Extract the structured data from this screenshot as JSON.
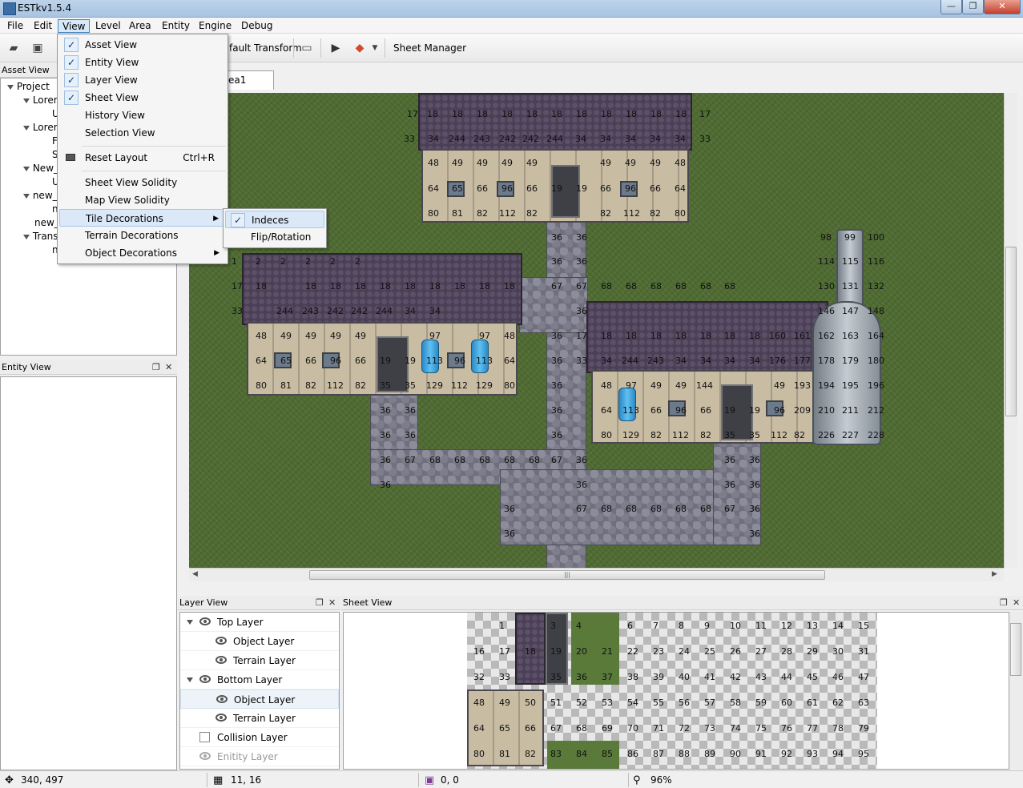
{
  "app": {
    "title": "ESTkv1.5.4"
  },
  "menu": [
    "File",
    "Edit",
    "View",
    "Level",
    "Area",
    "Entity",
    "Engine",
    "Debug"
  ],
  "toolbar": {
    "transform_label": "fault Transform",
    "sheet_manager": "Sheet Manager"
  },
  "asset_view": {
    "title": "Asset View",
    "items": [
      "Project",
      "Lorer",
      "U",
      "Lorer",
      "F",
      "S",
      "New_",
      "U",
      "new_",
      "n",
      "new_",
      "Trans",
      "n"
    ]
  },
  "entity_view": {
    "title": "Entity View"
  },
  "view_menu": {
    "items": [
      {
        "label": "Asset View",
        "checked": true
      },
      {
        "label": "Entity View",
        "checked": true
      },
      {
        "label": "Layer View",
        "checked": true
      },
      {
        "label": "Sheet View",
        "checked": true
      },
      {
        "label": "History View",
        "checked": false
      },
      {
        "label": "Selection View",
        "checked": false
      },
      {
        "label": "Reset Layout",
        "shortcut": "Ctrl+R"
      },
      {
        "label": "Sheet View Solidity"
      },
      {
        "label": "Map View Solidity"
      },
      {
        "label": "Tile Decorations",
        "submenu": true
      },
      {
        "label": "Terrain Decorations"
      },
      {
        "label": "Object Decorations",
        "submenu": true
      }
    ]
  },
  "tile_submenu": {
    "items": [
      {
        "label": "Indeces",
        "checked": true
      },
      {
        "label": "Flip/Rotation",
        "checked": false
      }
    ]
  },
  "map": {
    "tab": "ea1",
    "hscroll_grip": "|||"
  },
  "map_numbers": [
    [
      "17",
      508,
      143
    ],
    [
      "18",
      533,
      143
    ],
    [
      "18",
      564,
      143
    ],
    [
      "18",
      595,
      143
    ],
    [
      "18",
      626,
      143
    ],
    [
      "18",
      657,
      143
    ],
    [
      "18",
      688,
      143
    ],
    [
      "18",
      719,
      143
    ],
    [
      "18",
      750,
      143
    ],
    [
      "18",
      781,
      143
    ],
    [
      "18",
      812,
      143
    ],
    [
      "18",
      843,
      143
    ],
    [
      "17",
      873,
      143
    ],
    [
      "33",
      504,
      174
    ],
    [
      "34",
      534,
      174
    ],
    [
      "244",
      560,
      174
    ],
    [
      "243",
      591,
      174
    ],
    [
      "242",
      623,
      174
    ],
    [
      "242",
      652,
      174
    ],
    [
      "244",
      682,
      174
    ],
    [
      "34",
      718,
      174
    ],
    [
      "34",
      749,
      174
    ],
    [
      "34",
      780,
      174
    ],
    [
      "34",
      811,
      174
    ],
    [
      "34",
      842,
      174
    ],
    [
      "33",
      873,
      174
    ],
    [
      "48",
      534,
      204
    ],
    [
      "49",
      564,
      204
    ],
    [
      "49",
      595,
      204
    ],
    [
      "49",
      626,
      204
    ],
    [
      "49",
      657,
      204
    ],
    [
      "49",
      749,
      204
    ],
    [
      "49",
      780,
      204
    ],
    [
      "49",
      811,
      204
    ],
    [
      "48",
      842,
      204
    ],
    [
      "64",
      534,
      236
    ],
    [
      "65",
      564,
      236
    ],
    [
      "66",
      595,
      236
    ],
    [
      "96",
      626,
      236
    ],
    [
      "66",
      657,
      236
    ],
    [
      "19",
      688,
      236
    ],
    [
      "19",
      719,
      236
    ],
    [
      "66",
      749,
      236
    ],
    [
      "96",
      780,
      236
    ],
    [
      "66",
      811,
      236
    ],
    [
      "64",
      842,
      236
    ],
    [
      "80",
      534,
      267
    ],
    [
      "81",
      564,
      267
    ],
    [
      "82",
      595,
      267
    ],
    [
      "112",
      623,
      267
    ],
    [
      "82",
      657,
      267
    ],
    [
      "82",
      749,
      267
    ],
    [
      "112",
      778,
      267
    ],
    [
      "82",
      811,
      267
    ],
    [
      "80",
      842,
      267
    ],
    [
      "36",
      688,
      297
    ],
    [
      "36",
      719,
      297
    ],
    [
      "98",
      1024,
      297
    ],
    [
      "99",
      1054,
      297
    ],
    [
      "100",
      1083,
      297
    ],
    [
      "1",
      289,
      327
    ],
    [
      "2",
      319,
      327
    ],
    [
      "2",
      350,
      327
    ],
    [
      "2",
      381,
      327
    ],
    [
      "2",
      412,
      327
    ],
    [
      "2",
      443,
      327
    ],
    [
      "36",
      688,
      327
    ],
    [
      "36",
      719,
      327
    ],
    [
      "114",
      1021,
      327
    ],
    [
      "115",
      1051,
      327
    ],
    [
      "116",
      1083,
      327
    ],
    [
      "17",
      289,
      358
    ],
    [
      "18",
      319,
      358
    ],
    [
      "18",
      381,
      358
    ],
    [
      "18",
      412,
      358
    ],
    [
      "18",
      443,
      358
    ],
    [
      "18",
      474,
      358
    ],
    [
      "18",
      505,
      358
    ],
    [
      "18",
      536,
      358
    ],
    [
      "18",
      567,
      358
    ],
    [
      "18",
      598,
      358
    ],
    [
      "18",
      629,
      358
    ],
    [
      "67",
      688,
      358
    ],
    [
      "67",
      719,
      358
    ],
    [
      "68",
      750,
      358
    ],
    [
      "68",
      781,
      358
    ],
    [
      "68",
      812,
      358
    ],
    [
      "68",
      843,
      358
    ],
    [
      "68",
      874,
      358
    ],
    [
      "68",
      904,
      358
    ],
    [
      "130",
      1021,
      358
    ],
    [
      "131",
      1051,
      358
    ],
    [
      "132",
      1083,
      358
    ],
    [
      "33",
      289,
      389
    ],
    [
      "244",
      345,
      389
    ],
    [
      "243",
      377,
      389
    ],
    [
      "242",
      408,
      389
    ],
    [
      "242",
      438,
      389
    ],
    [
      "244",
      469,
      389
    ],
    [
      "34",
      505,
      389
    ],
    [
      "34",
      536,
      389
    ],
    [
      "36",
      719,
      389
    ],
    [
      "146",
      1021,
      389
    ],
    [
      "147",
      1051,
      389
    ],
    [
      "148",
      1083,
      389
    ],
    [
      "48",
      319,
      420
    ],
    [
      "49",
      350,
      420
    ],
    [
      "49",
      381,
      420
    ],
    [
      "49",
      412,
      420
    ],
    [
      "49",
      443,
      420
    ],
    [
      "97",
      536,
      420
    ],
    [
      "97",
      598,
      420
    ],
    [
      "48",
      629,
      420
    ],
    [
      "36",
      688,
      420
    ],
    [
      "17",
      719,
      420
    ],
    [
      "18",
      750,
      420
    ],
    [
      "18",
      781,
      420
    ],
    [
      "18",
      812,
      420
    ],
    [
      "18",
      843,
      420
    ],
    [
      "18",
      874,
      420
    ],
    [
      "18",
      904,
      420
    ],
    [
      "18",
      935,
      420
    ],
    [
      "160",
      960,
      420
    ],
    [
      "161",
      991,
      420
    ],
    [
      "162",
      1021,
      420
    ],
    [
      "163",
      1051,
      420
    ],
    [
      "164",
      1083,
      420
    ],
    [
      "64",
      319,
      451
    ],
    [
      "65",
      350,
      451
    ],
    [
      "66",
      381,
      451
    ],
    [
      "96",
      412,
      451
    ],
    [
      "66",
      443,
      451
    ],
    [
      "19",
      474,
      451
    ],
    [
      "19",
      505,
      451
    ],
    [
      "113",
      532,
      451
    ],
    [
      "96",
      567,
      451
    ],
    [
      "113",
      594,
      451
    ],
    [
      "64",
      629,
      451
    ],
    [
      "36",
      688,
      451
    ],
    [
      "33",
      719,
      451
    ],
    [
      "34",
      750,
      451
    ],
    [
      "244",
      776,
      451
    ],
    [
      "243",
      808,
      451
    ],
    [
      "34",
      843,
      451
    ],
    [
      "34",
      874,
      451
    ],
    [
      "34",
      904,
      451
    ],
    [
      "34",
      935,
      451
    ],
    [
      "176",
      960,
      451
    ],
    [
      "177",
      991,
      451
    ],
    [
      "178",
      1021,
      451
    ],
    [
      "179",
      1051,
      451
    ],
    [
      "180",
      1083,
      451
    ],
    [
      "80",
      319,
      482
    ],
    [
      "81",
      350,
      482
    ],
    [
      "82",
      381,
      482
    ],
    [
      "112",
      408,
      482
    ],
    [
      "82",
      443,
      482
    ],
    [
      "35",
      474,
      482
    ],
    [
      "35",
      505,
      482
    ],
    [
      "129",
      532,
      482
    ],
    [
      "112",
      563,
      482
    ],
    [
      "129",
      594,
      482
    ],
    [
      "80",
      629,
      482
    ],
    [
      "36",
      688,
      482
    ],
    [
      "48",
      750,
      482
    ],
    [
      "97",
      781,
      482
    ],
    [
      "49",
      812,
      482
    ],
    [
      "49",
      843,
      482
    ],
    [
      "144",
      869,
      482
    ],
    [
      "49",
      966,
      482
    ],
    [
      "193",
      991,
      482
    ],
    [
      "194",
      1021,
      482
    ],
    [
      "195",
      1051,
      482
    ],
    [
      "196",
      1083,
      482
    ],
    [
      "36",
      474,
      513
    ],
    [
      "36",
      505,
      513
    ],
    [
      "36",
      688,
      513
    ],
    [
      "64",
      750,
      513
    ],
    [
      "113",
      777,
      513
    ],
    [
      "66",
      812,
      513
    ],
    [
      "96",
      843,
      513
    ],
    [
      "66",
      874,
      513
    ],
    [
      "19",
      904,
      513
    ],
    [
      "19",
      935,
      513
    ],
    [
      "96",
      966,
      513
    ],
    [
      "209",
      991,
      513
    ],
    [
      "210",
      1021,
      513
    ],
    [
      "211",
      1051,
      513
    ],
    [
      "212",
      1083,
      513
    ],
    [
      "36",
      474,
      544
    ],
    [
      "36",
      505,
      544
    ],
    [
      "36",
      688,
      544
    ],
    [
      "80",
      750,
      544
    ],
    [
      "129",
      777,
      544
    ],
    [
      "82",
      812,
      544
    ],
    [
      "112",
      839,
      544
    ],
    [
      "82",
      874,
      544
    ],
    [
      "35",
      904,
      544
    ],
    [
      "35",
      935,
      544
    ],
    [
      "112",
      962,
      544
    ],
    [
      "82",
      991,
      544
    ],
    [
      "226",
      1021,
      544
    ],
    [
      "227",
      1051,
      544
    ],
    [
      "228",
      1083,
      544
    ],
    [
      "36",
      474,
      575
    ],
    [
      "67",
      505,
      575
    ],
    [
      "68",
      536,
      575
    ],
    [
      "68",
      567,
      575
    ],
    [
      "68",
      598,
      575
    ],
    [
      "68",
      629,
      575
    ],
    [
      "68",
      660,
      575
    ],
    [
      "67",
      688,
      575
    ],
    [
      "36",
      719,
      575
    ],
    [
      "36",
      904,
      575
    ],
    [
      "36",
      935,
      575
    ],
    [
      "36",
      474,
      606
    ],
    [
      "36",
      719,
      606
    ],
    [
      "36",
      904,
      606
    ],
    [
      "36",
      935,
      606
    ],
    [
      "36",
      629,
      636
    ],
    [
      "67",
      719,
      636
    ],
    [
      "68",
      750,
      636
    ],
    [
      "68",
      781,
      636
    ],
    [
      "68",
      812,
      636
    ],
    [
      "68",
      843,
      636
    ],
    [
      "68",
      874,
      636
    ],
    [
      "67",
      904,
      636
    ],
    [
      "36",
      935,
      636
    ],
    [
      "36",
      629,
      667
    ],
    [
      "36",
      935,
      667
    ]
  ],
  "layer_view": {
    "title": "Layer View",
    "rows": [
      {
        "label": "Top Layer",
        "indent": 0,
        "expand": true,
        "eye": true
      },
      {
        "label": "Object Layer",
        "indent": 1,
        "eye": true
      },
      {
        "label": "Terrain Layer",
        "indent": 1,
        "eye": true
      },
      {
        "label": "Bottom Layer",
        "indent": 0,
        "expand": true,
        "eye": true
      },
      {
        "label": "Object Layer",
        "indent": 1,
        "eye": true,
        "selected": true
      },
      {
        "label": "Terrain Layer",
        "indent": 1,
        "eye": true
      },
      {
        "label": "Collision Layer",
        "indent": 0,
        "checkbox": true
      },
      {
        "label": "Enitity Layer",
        "indent": 0,
        "eye": true,
        "disabled": true
      }
    ]
  },
  "sheet_view": {
    "title": "Sheet View",
    "rows": [
      [
        "",
        "1",
        "",
        "3",
        "4",
        "",
        "6",
        "7",
        "8",
        "9",
        "10",
        "11",
        "12",
        "13",
        "14",
        "15"
      ],
      [
        "16",
        "17",
        "18",
        "19",
        "20",
        "21",
        "22",
        "23",
        "24",
        "25",
        "26",
        "27",
        "28",
        "29",
        "30",
        "31"
      ],
      [
        "32",
        "33",
        "",
        "35",
        "36",
        "37",
        "38",
        "39",
        "40",
        "41",
        "42",
        "43",
        "44",
        "45",
        "46",
        "47"
      ],
      [
        "48",
        "49",
        "50",
        "51",
        "52",
        "53",
        "54",
        "55",
        "56",
        "57",
        "58",
        "59",
        "60",
        "61",
        "62",
        "63"
      ],
      [
        "64",
        "65",
        "66",
        "67",
        "68",
        "69",
        "70",
        "71",
        "72",
        "73",
        "74",
        "75",
        "76",
        "77",
        "78",
        "79"
      ],
      [
        "80",
        "81",
        "82",
        "83",
        "84",
        "85",
        "86",
        "87",
        "88",
        "89",
        "90",
        "91",
        "92",
        "93",
        "94",
        "95"
      ]
    ]
  },
  "status": {
    "cursor": "340, 497",
    "tile": "11, 16",
    "sel": "0, 0",
    "zoom": "96%"
  }
}
